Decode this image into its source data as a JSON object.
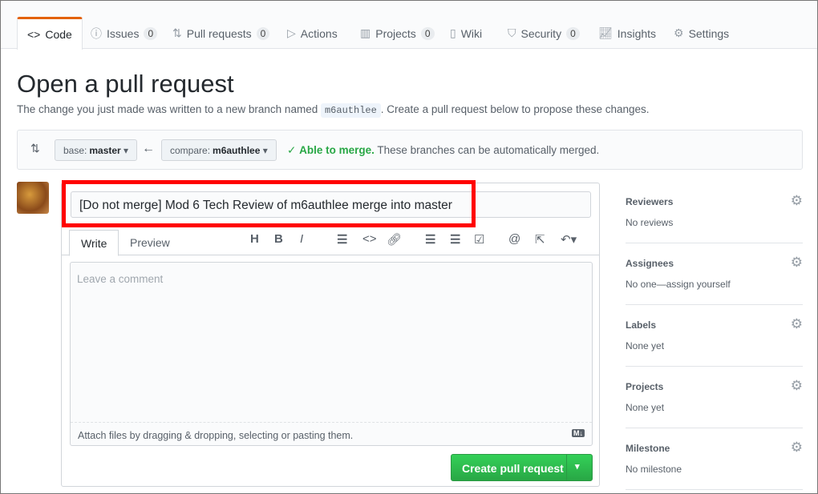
{
  "tabs": [
    {
      "label": "Code",
      "icon": "code-icon"
    },
    {
      "label": "Issues",
      "count": "0",
      "icon": "issue-icon"
    },
    {
      "label": "Pull requests",
      "count": "0",
      "icon": "pull-request-icon"
    },
    {
      "label": "Actions",
      "icon": "play-icon"
    },
    {
      "label": "Projects",
      "count": "0",
      "icon": "project-icon"
    },
    {
      "label": "Wiki",
      "icon": "book-icon"
    },
    {
      "label": "Security",
      "count": "0",
      "icon": "shield-icon"
    },
    {
      "label": "Insights",
      "icon": "graph-icon"
    },
    {
      "label": "Settings",
      "icon": "gear-icon"
    }
  ],
  "page": {
    "title": "Open a pull request",
    "subtitle_pre": "The change you just made was written to a new branch named",
    "branch": "m6authlee",
    "subtitle_post": ". Create a pull request below to propose these changes."
  },
  "merge": {
    "base_label": "base:",
    "base": "master",
    "compare_label": "compare:",
    "compare": "m6authlee",
    "status": "Able to merge.",
    "status_detail": "These branches can be automatically merged.",
    "status_color": "#28a745"
  },
  "form": {
    "title_value": "[Do not merge] Mod 6 Tech Review of m6authlee merge into master",
    "tab_write": "Write",
    "tab_preview": "Preview",
    "placeholder": "Leave a comment",
    "attach_text": "Attach files by dragging & dropping, selecting or pasting them.",
    "markdown_badge": "M↓",
    "submit": "Create pull request",
    "highlight_color": "#ff0000"
  },
  "sidebar": [
    {
      "heading": "Reviewers",
      "value": "No reviews"
    },
    {
      "heading": "Assignees",
      "value": "No one—assign yourself"
    },
    {
      "heading": "Labels",
      "value": "None yet"
    },
    {
      "heading": "Projects",
      "value": "None yet"
    },
    {
      "heading": "Milestone",
      "value": "No milestone"
    }
  ]
}
